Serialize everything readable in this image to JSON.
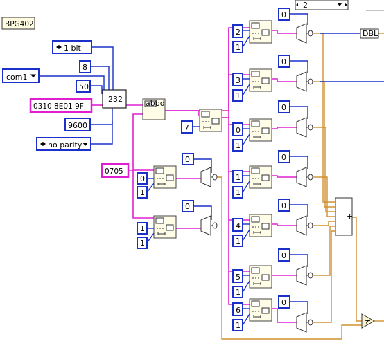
{
  "diagram": {
    "label": "BPG402",
    "serial": {
      "stop_bits": "1 bit",
      "data_bits": "8",
      "port": "com1",
      "timeout": "50",
      "command": "0310 8E01 9F",
      "baud": "9600",
      "parity": "no parity",
      "node_label": "232"
    },
    "match_pattern": "0705",
    "subset_count": "7",
    "case_selector": "2",
    "output_tag": "DBL",
    "subset_offsets_top": [
      "0",
      "1"
    ],
    "subset_lengths_top": [
      "1",
      "1"
    ],
    "select_default": "0",
    "channel_offsets": [
      "2",
      "3",
      "0",
      "1",
      "4",
      "5",
      "6"
    ],
    "channel_lengths": [
      "1",
      "1",
      "1",
      "1",
      "1",
      "1",
      "1"
    ],
    "channel_defaults": [
      "0",
      "0",
      "0",
      "0",
      "0",
      "0",
      "0"
    ]
  }
}
